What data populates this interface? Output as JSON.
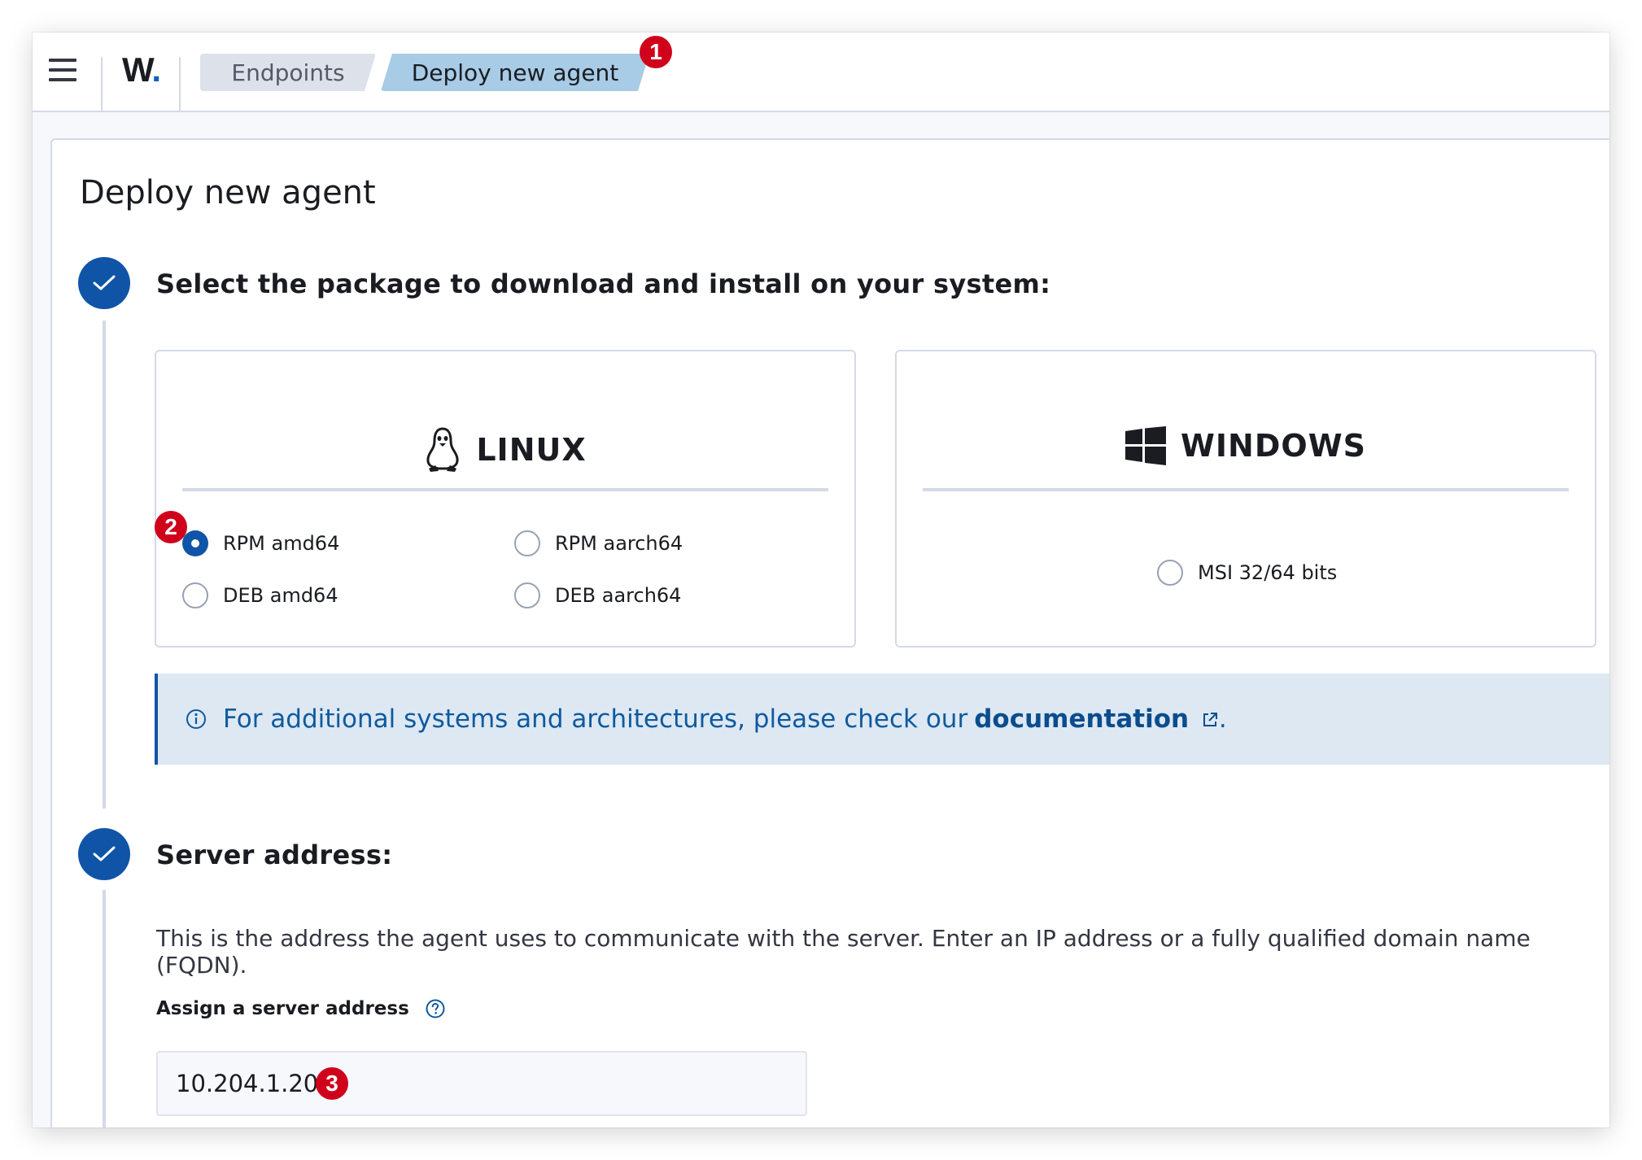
{
  "header": {
    "logo_text": "W",
    "logo_dot": ".",
    "breadcrumbs": [
      "Endpoints",
      "Deploy new agent"
    ]
  },
  "badges": [
    "1",
    "2",
    "3"
  ],
  "page": {
    "title": "Deploy new agent"
  },
  "step1": {
    "title": "Select the package to download and install on your system:",
    "linux": {
      "name": "LINUX",
      "icon": "linux-tux-icon",
      "options": [
        {
          "label": "RPM amd64",
          "checked": true
        },
        {
          "label": "RPM aarch64",
          "checked": false
        },
        {
          "label": "DEB amd64",
          "checked": false
        },
        {
          "label": "DEB aarch64",
          "checked": false
        }
      ]
    },
    "windows": {
      "name": "WINDOWS",
      "icon": "windows-logo-icon",
      "options": [
        {
          "label": "MSI 32/64 bits",
          "checked": false
        }
      ]
    },
    "callout": {
      "text": "For additional systems and architectures, please check our",
      "link": "documentation",
      "suffix": "."
    }
  },
  "step2": {
    "title": "Server address:",
    "description": "This is the address the agent uses to communicate with the server. Enter an IP address or a fully qualified domain name (FQDN).",
    "field_label": "Assign a server address",
    "field_value": "10.204.1.203"
  },
  "colors": {
    "accent": "#1054a8",
    "badge": "#d0021b",
    "callout_bg": "#dde8f3",
    "breadcrumb_active": "#a8cbe6"
  }
}
